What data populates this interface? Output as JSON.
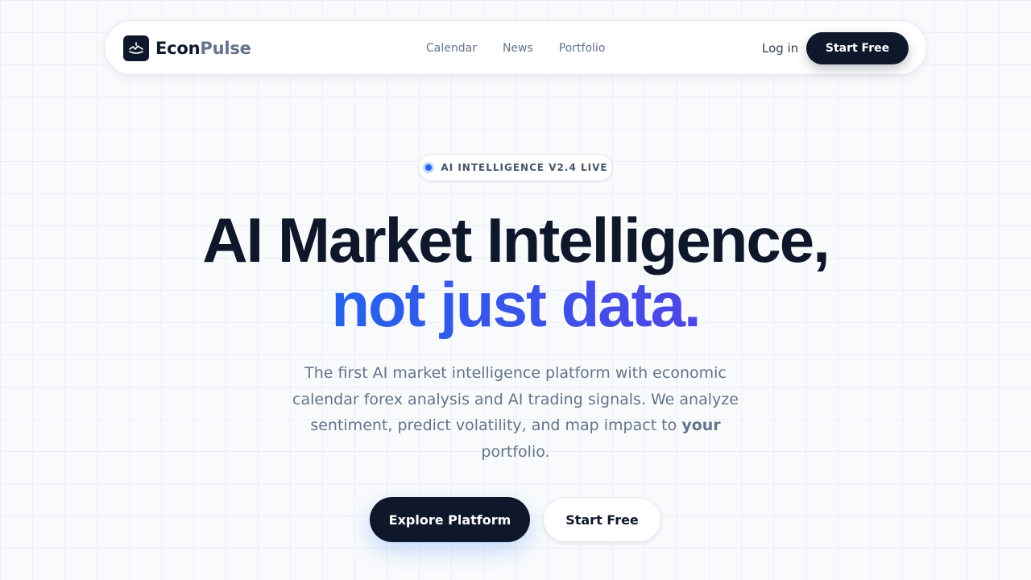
{
  "nav": {
    "brand_primary": "Econ",
    "brand_secondary": "Pulse",
    "logo_icon": "wave-icon",
    "links": [
      "Calendar",
      "News",
      "Portfolio"
    ],
    "login_label": "Log in",
    "cta_label": "Start Free"
  },
  "badge": {
    "text": "AI INTELLIGENCE V2.4 LIVE"
  },
  "hero": {
    "headline_line1": "AI Market Intelligence,",
    "headline_line2": "not just data.",
    "subtitle_before": "The first AI market intelligence platform with economic calendar forex analysis and AI trading signals. We analyze sentiment, predict volatility, and map impact to ",
    "subtitle_emphasis": "your",
    "subtitle_after": " portfolio."
  },
  "cta": {
    "primary_label": "Explore Platform",
    "secondary_label": "Start Free"
  },
  "colors": {
    "ink": "#0f172a",
    "muted": "#64748b",
    "accent_start": "#2563eb",
    "accent_end": "#4f46e5"
  }
}
